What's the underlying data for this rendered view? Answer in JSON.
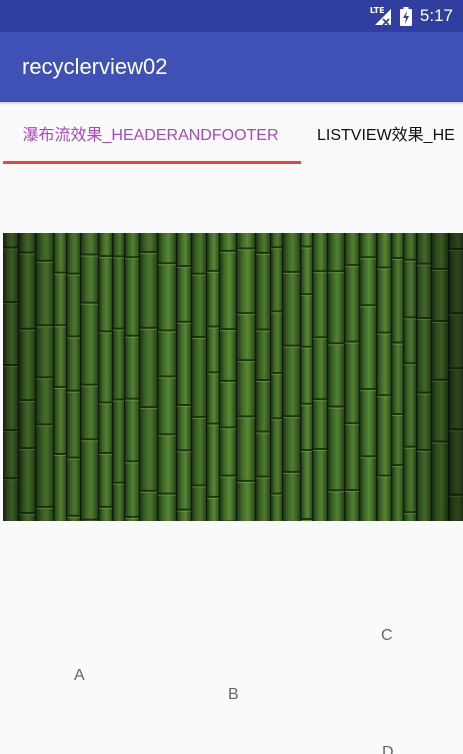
{
  "status_bar": {
    "network_type": "LTE",
    "time": "5:17"
  },
  "app_bar": {
    "title": "recyclerview02"
  },
  "tabs": [
    {
      "label": "瀑布流效果_HEADERANDFOOTER",
      "selected": true
    },
    {
      "label": "LISTVIEW效果_HE",
      "selected": false
    }
  ],
  "colors": {
    "status_bar": "#303f9f",
    "app_bar": "#3f51b5",
    "tab_selected_text": "#ab47bc",
    "tab_indicator": "#f44336",
    "background": "#fafafa"
  },
  "header_image": {
    "subject": "bamboo"
  },
  "grid_items": [
    "A",
    "B",
    "C",
    "D"
  ]
}
